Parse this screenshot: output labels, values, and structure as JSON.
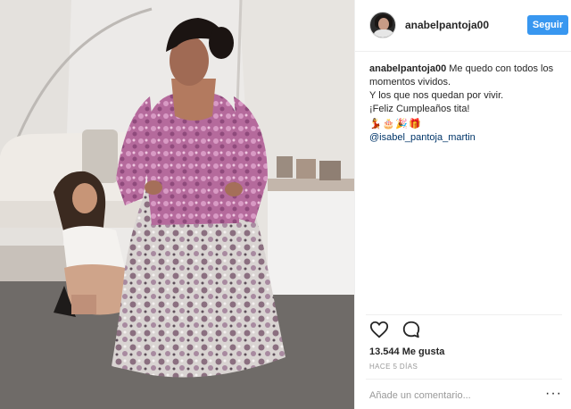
{
  "post": {
    "username": "anabelpantoja00",
    "follow_label": "Seguir",
    "caption": {
      "user": "anabelpantoja00",
      "line1": "Me quedo con todos los",
      "line2": "momentos vividos.",
      "line3": "Y los que nos quedan por vivir.",
      "line4": "¡Feliz Cumpleaños tita!",
      "emojis": [
        "💃",
        "🎂",
        "🎉",
        "🎁"
      ],
      "mention": "@isabel_pantoja_martin"
    },
    "likes": "13.544 Me gusta",
    "time": "HACE 5 DÍAS",
    "comment_placeholder": "Añade un comentario...",
    "more_glyph": "···"
  },
  "icons": {
    "like": "heart-outline-icon",
    "comment": "speech-bubble-icon",
    "more": "ellipsis-icon"
  },
  "colors": {
    "follow_button": "#3897f0",
    "mention": "#003569",
    "muted": "#999999"
  }
}
